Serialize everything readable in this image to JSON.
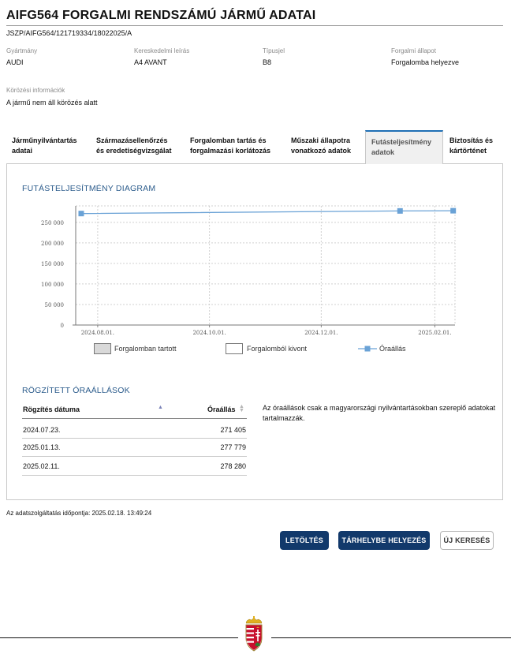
{
  "header": {
    "title": "AIFG564 FORGALMI RENDSZÁMÚ JÁRMŰ ADATAI",
    "doc_id": "JSZP/AIFG564/121719334/18022025/A"
  },
  "info": {
    "manufacturer_label": "Gyártmány",
    "manufacturer_value": "AUDI",
    "trade_name_label": "Kereskedelmi leírás",
    "trade_name_value": "A4 AVANT",
    "type_label": "Típusjel",
    "type_value": "B8",
    "status_label": "Forgalmi állapot",
    "status_value": "Forgalomba helyezve",
    "wanted_label": "Körözési információk",
    "wanted_value": "A jármű nem áll körözés alatt"
  },
  "tabs": [
    {
      "line1": "Járműnyilvántartás",
      "line2": "adatai"
    },
    {
      "line1": "Származásellenőrzés",
      "line2": "és eredetiségvizsgálat"
    },
    {
      "line1": "Forgalomban tartás és",
      "line2": "forgalmazási korlátozás"
    },
    {
      "line1": "Műszaki állapotra",
      "line2": "vonatkozó adatok"
    },
    {
      "line1": "Futásteljesítmény",
      "line2": "adatok"
    },
    {
      "line1": "Biztosítás és",
      "line2": "kártörténet"
    }
  ],
  "active_tab": "Futásteljesítmény adatok",
  "chart_section_title": "FUTÁSTELJESÍTMÉNY DIAGRAM",
  "chart_data": {
    "type": "line",
    "title": "FUTÁSTELJESÍTMÉNY DIAGRAM",
    "x_tick_labels": [
      "2024.08.01.",
      "2024.10.01.",
      "2024.12.01.",
      "2025.02.01."
    ],
    "x_ticks": [
      "2024-08-01",
      "2024-10-01",
      "2024-12-01",
      "2025-02-01"
    ],
    "xlim": [
      "2024-07-20",
      "2025-02-12"
    ],
    "y_ticks": [
      0,
      50000,
      100000,
      150000,
      200000,
      250000
    ],
    "y_tick_labels": [
      "0",
      "50 000",
      "100 000",
      "150 000",
      "200 000",
      "250 000"
    ],
    "ylim": [
      0,
      290000
    ],
    "grid": true,
    "series": [
      {
        "name": "Óraállás",
        "color": "#6aa2d6",
        "points": [
          {
            "x": "2024-07-23",
            "y": 271405
          },
          {
            "x": "2025-01-13",
            "y": 277779
          },
          {
            "x": "2025-02-11",
            "y": 278280
          }
        ]
      }
    ],
    "legend": [
      {
        "label": "Forgalomban tartott",
        "kind": "filled-box",
        "color": "#d9d9d9"
      },
      {
        "label": "Forgalomból kivont",
        "kind": "empty-box",
        "color": "#ffffff"
      },
      {
        "label": "Óraállás",
        "kind": "line-marker",
        "color": "#6aa2d6"
      }
    ],
    "legend_position": "bottom"
  },
  "records": {
    "title": "RÖGZÍTETT ÓRAÁLLÁSOK",
    "col_date": "Rögzítés dátuma",
    "col_value": "Óraállás",
    "rows": [
      {
        "date": "2024.07.23.",
        "value": "271 405"
      },
      {
        "date": "2025.01.13.",
        "value": "277 779"
      },
      {
        "date": "2025.02.11.",
        "value": "278 280"
      }
    ],
    "note": "Az óraállások csak a magyarországi nyilvántartásokban szereplő adatokat tartalmazzák."
  },
  "timestamp": "Az adatszolgáltatás időpontja: 2025.02.18. 13:49:24",
  "buttons": {
    "download": "LETÖLTÉS",
    "storage": "TÁRHELYBE HELYEZÉS",
    "new_search": "ÚJ KERESÉS"
  },
  "colors": {
    "primary_button": "#12396b",
    "section_title": "#2c5c8c",
    "active_tab_accent": "#1f6fb5",
    "series_line": "#6aa2d6",
    "crest_red": "#c8102e",
    "crest_green": "#2e7d32",
    "crest_gold": "#e0b020"
  }
}
